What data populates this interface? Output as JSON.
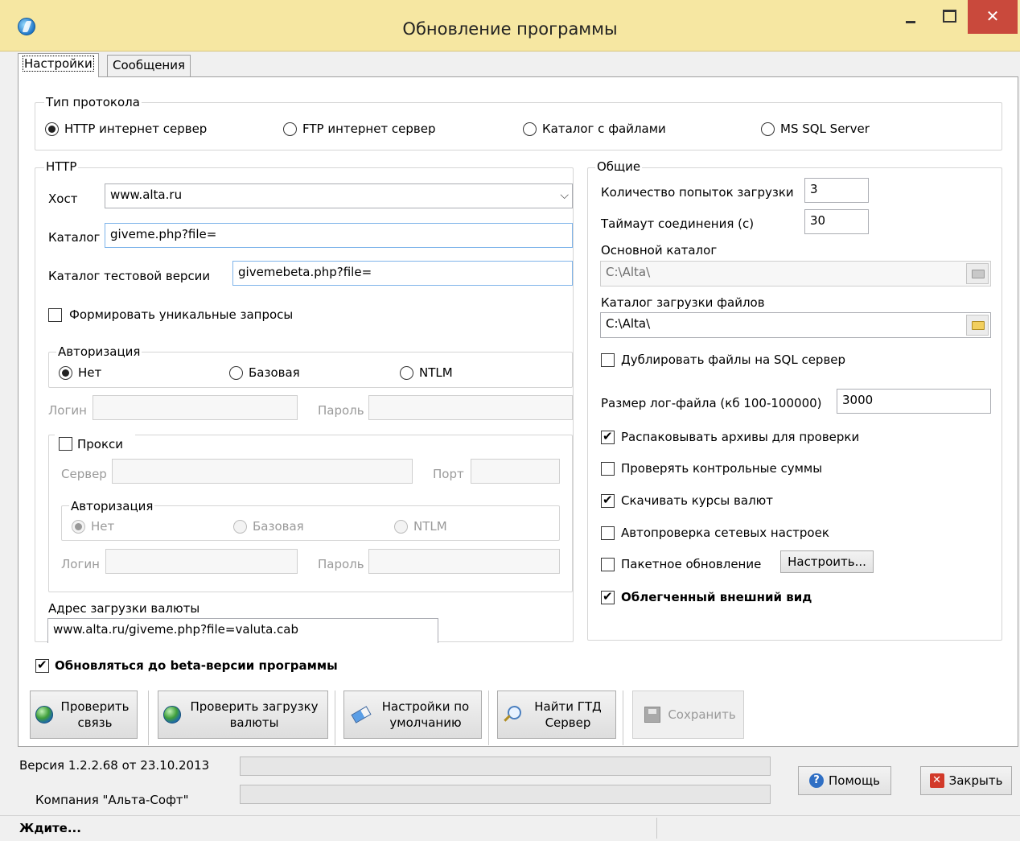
{
  "window": {
    "title": "Обновление программы",
    "close_glyph": "✕"
  },
  "tabs": [
    {
      "label": "Настройки",
      "active": true
    },
    {
      "label": "Сообщения",
      "active": false
    }
  ],
  "protocol": {
    "legend": "Тип протокола",
    "options": [
      {
        "label": "HTTP интернет сервер",
        "selected": true
      },
      {
        "label": "FTP интернет сервер",
        "selected": false
      },
      {
        "label": "Каталог с файлами",
        "selected": false
      },
      {
        "label": "MS SQL Server",
        "selected": false
      }
    ]
  },
  "http": {
    "legend": "HTTP",
    "host_label": "Хост",
    "host_value": "www.alta.ru",
    "catalog_label": "Каталог",
    "catalog_value": "giveme.php?file=",
    "test_catalog_label": "Каталог тестовой версии",
    "test_catalog_value": "givemebeta.php?file=",
    "unique_requests_label": "Формировать уникальные запросы",
    "auth_legend": "Авторизация",
    "auth_options": [
      "Нет",
      "Базовая",
      "NTLM"
    ],
    "login_label": "Логин",
    "password_label": "Пароль",
    "proxy_label": "Прокси",
    "server_label": "Сервер",
    "port_label": "Порт",
    "proxy_auth_legend": "Авторизация",
    "proxy_auth_options": [
      "Нет",
      "Базовая",
      "NTLM"
    ],
    "proxy_login_label": "Логин",
    "proxy_password_label": "Пароль",
    "currency_url_label": "Адрес загрузки валюты",
    "currency_url_value": "www.alta.ru/giveme.php?file=valuta.cab"
  },
  "general": {
    "legend": "Общие",
    "attempts_label": "Количество попыток загрузки",
    "attempts_value": "3",
    "timeout_label": "Таймаут соединения (с)",
    "timeout_value": "30",
    "main_dir_label": "Основной каталог",
    "main_dir_value": "C:\\Alta\\",
    "download_dir_label": "Каталог загрузки файлов",
    "download_dir_value": "C:\\Alta\\",
    "dup_sql_label": "Дублировать файлы на SQL сервер",
    "log_size_label": "Размер лог-файла (кб 100-100000)",
    "log_size_value": "3000",
    "unpack_label": "Распаковывать архивы для проверки",
    "checksums_label": "Проверять контрольные суммы",
    "rates_label": "Скачивать курсы валют",
    "autocheck_label": "Автопроверка сетевых настроек",
    "batch_label": "Пакетное обновление",
    "configure_button": "Настроить...",
    "light_view_label": "Облегченный внешний вид"
  },
  "beta_label": "Обновляться до beta-версии программы",
  "actions": {
    "check_conn_1": "Проверить",
    "check_conn_2": "связь",
    "check_currency_1": "Проверить загрузку",
    "check_currency_2": "валюты",
    "defaults_1": "Настройки по",
    "defaults_2": "умолчанию",
    "find_gtd_1": "Найти ГТД",
    "find_gtd_2": "Сервер",
    "save": "Сохранить"
  },
  "footer": {
    "version": "Версия 1.2.2.68 от 23.10.2013",
    "company": "Компания \"Альта-Софт\"",
    "help": "Помощь",
    "close": "Закрыть",
    "help_glyph": "?",
    "close_glyph": "✕"
  },
  "status": "Ждите...",
  "colors": {
    "titlebar": "#f6e7a2",
    "close_button": "#c9493c"
  }
}
